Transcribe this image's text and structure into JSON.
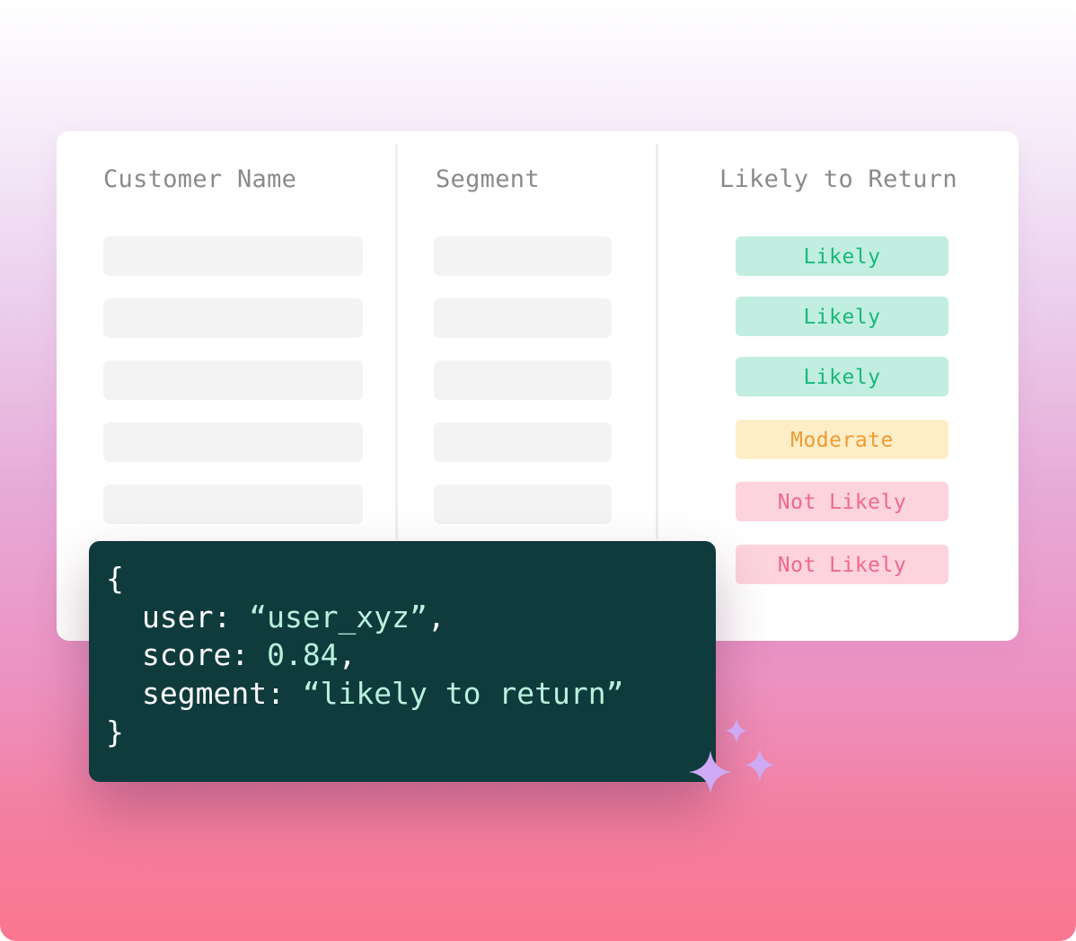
{
  "table": {
    "headers": {
      "customer_name": "Customer Name",
      "segment": "Segment",
      "likely_to_return": "Likely to Return"
    },
    "rows": [
      {
        "status": "Likely"
      },
      {
        "status": "Likely"
      },
      {
        "status": "Likely"
      },
      {
        "status": "Moderate"
      },
      {
        "status": "Not Likely"
      },
      {
        "status": "Not Likely"
      }
    ]
  },
  "status_colors": {
    "Likely": {
      "bg": "#c2eee1",
      "fg": "#18b97a"
    },
    "Moderate": {
      "bg": "#fdeec8",
      "fg": "#f29a32"
    },
    "Not Likely": {
      "bg": "#fdd3dd",
      "fg": "#ee6a8c"
    }
  },
  "code": {
    "open_brace": "{",
    "user_key": "user: ",
    "user_value": "“user_xyz”",
    "user_suffix": ",",
    "score_key": "score: ",
    "score_value": "0.84",
    "score_suffix": ",",
    "segment_key": "segment: ",
    "segment_value": "“likely to return”",
    "close_brace": "}"
  },
  "decoration": {
    "icon": "sparkles-icon",
    "color": "#cfaaf4"
  }
}
